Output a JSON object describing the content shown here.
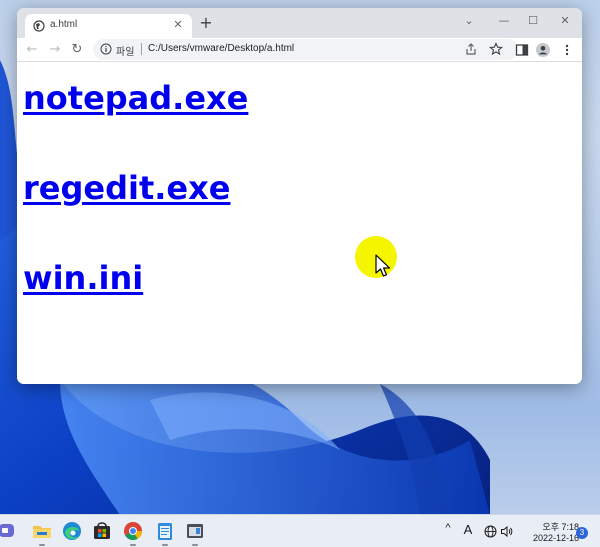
{
  "browser": {
    "tab": {
      "title": "a.html",
      "close_symbol": "✕"
    },
    "new_tab_symbol": "+",
    "address": {
      "scheme_label": "파일",
      "url": "C:/Users/vmware/Desktop/a.html"
    },
    "window_controls": {
      "list": "⌄",
      "minimize": "—",
      "maximize": "☐",
      "close": "✕"
    },
    "nav": {
      "back": "←",
      "forward": "→",
      "reload": "↻"
    }
  },
  "page": {
    "links": [
      {
        "text": "notepad.exe"
      },
      {
        "text": "regedit.exe"
      },
      {
        "text": "win.ini"
      }
    ]
  },
  "taskbar": {
    "apps": [
      "chat-icon",
      "file-explorer-icon",
      "edge-icon",
      "store-icon",
      "chrome-icon",
      "notepad-icon",
      "app-icon"
    ],
    "tray": {
      "chevron": "^",
      "ime": "A"
    },
    "clock": {
      "time": "오후 7:18",
      "date": "2022-12-16"
    },
    "notification_count": "3"
  },
  "colors": {
    "link": "#0000ee",
    "cursor_highlight": "#f5f500",
    "accent": "#2c63d8"
  }
}
